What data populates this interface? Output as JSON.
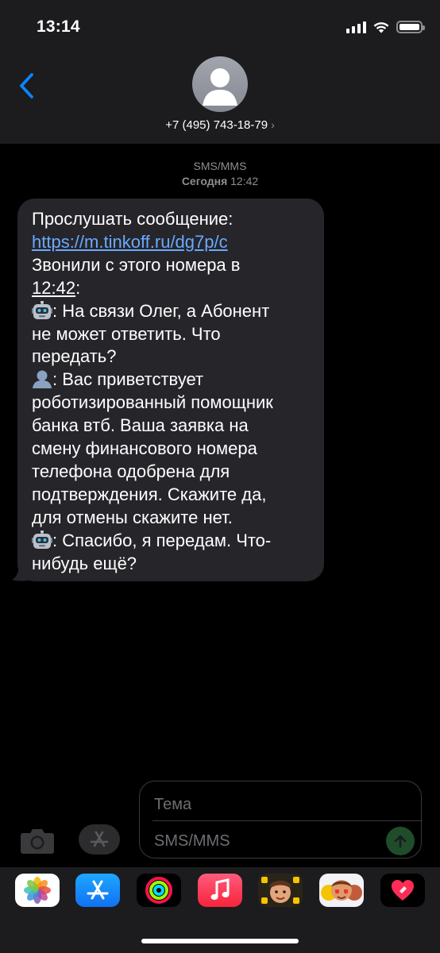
{
  "status_bar": {
    "time": "13:14"
  },
  "header": {
    "contact": "+7 (495) 743-18-79",
    "chevron": "›"
  },
  "meta": {
    "service": "SMS/MMS",
    "day": "Сегодня",
    "time": "12:42"
  },
  "message": {
    "line1": "Прослушать сообщение:",
    "link": "https://m.tinkoff.ru/dg7p/c",
    "line3": "Звонили с этого номера в",
    "call_time": "12:42",
    "colon": ":",
    "robot_emoji": "robot-emoji",
    "user_emoji": "bust-silhouette-emoji",
    "robot_say1_a": ":  На связи Олег, а Абонент",
    "robot_say1_b": "не может ответить. Что",
    "robot_say1_c": "передать?",
    "user_say_a": ":  Вас приветствует",
    "user_say_b": "роботизированный помощник",
    "user_say_c": "банка втб. Ваша заявка на",
    "user_say_d": "смену финансового номера",
    "user_say_e": "телефона одобрена для",
    "user_say_f": "подтверждения. Скажите да,",
    "user_say_g": "для отмены скажите нет.",
    "robot_say2_a": ":  Спасибо, я передам. Что-",
    "robot_say2_b": "нибудь ещё?"
  },
  "compose": {
    "subject_placeholder": "Тема",
    "body_placeholder": "SMS/MMS"
  },
  "icons": {
    "back": "chevron-left-icon",
    "camera": "camera-icon",
    "apps": "app-store-icon",
    "send": "arrow-up-icon"
  },
  "app_strip": [
    "photos",
    "app-store",
    "activity",
    "music",
    "memoji",
    "memoji-stickers",
    "digital-touch"
  ],
  "colors": {
    "accent": "#0a84ff",
    "link": "#6aa9ff",
    "bubble": "#26252a",
    "header": "#1c1c1e"
  }
}
